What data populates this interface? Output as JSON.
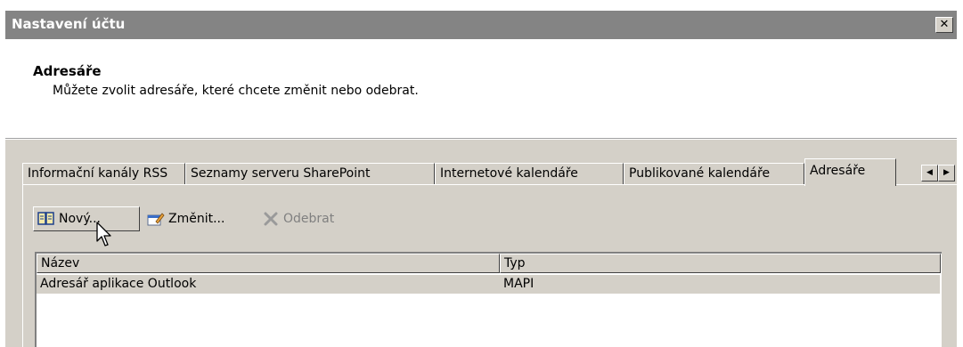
{
  "window": {
    "title": "Nastavení účtu",
    "close_glyph": "✕"
  },
  "header": {
    "title": "Adresáře",
    "description": "Můžete zvolit adresáře, které chcete změnit nebo odebrat."
  },
  "tabs": [
    {
      "label": "Informační kanály RSS",
      "active": false
    },
    {
      "label": "Seznamy serveru SharePoint",
      "active": false
    },
    {
      "label": "Internetové kalendáře",
      "active": false
    },
    {
      "label": "Publikované kalendáře",
      "active": false
    },
    {
      "label": "Adresáře",
      "active": true
    }
  ],
  "tab_scroll": {
    "left_glyph": "◀",
    "right_glyph": "▶"
  },
  "toolbar": {
    "new_label": "Nový...",
    "new_icon": "address-book-icon",
    "change_label": "Změnit...",
    "change_icon": "properties-icon",
    "remove_label": "Odebrat",
    "remove_icon": "delete-x-icon",
    "remove_enabled": false
  },
  "list": {
    "columns": [
      "Název",
      "Typ"
    ],
    "rows": [
      {
        "name": "Adresář aplikace Outlook",
        "type": "MAPI",
        "selected": true
      }
    ]
  },
  "colors": {
    "titlebar": "#848484",
    "dialog_face": "#d4d0c8",
    "disabled_text": "#808080"
  }
}
